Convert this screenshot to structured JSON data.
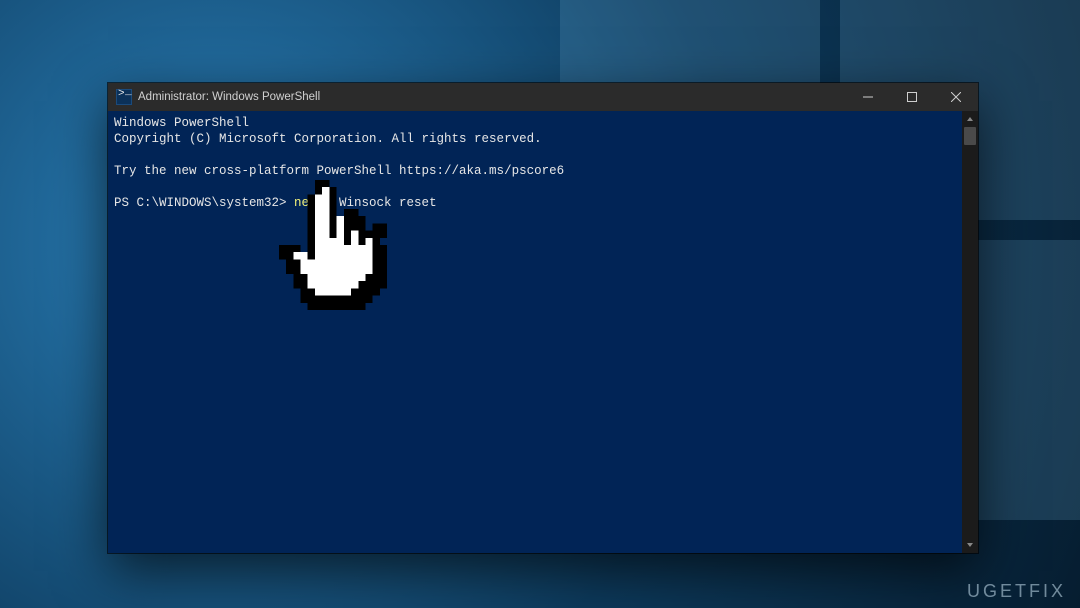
{
  "desktop": {
    "watermark": "UGETFIX"
  },
  "window": {
    "title": "Administrator: Windows PowerShell",
    "icons": {
      "app": "powershell-icon",
      "minimize": "minimize-icon",
      "maximize": "maximize-icon",
      "close": "close-icon"
    }
  },
  "terminal": {
    "line1": "Windows PowerShell",
    "line2": "Copyright (C) Microsoft Corporation. All rights reserved.",
    "line3": "",
    "line4": "Try the new cross-platform PowerShell https://aka.ms/pscore6",
    "line5": "",
    "prompt": "PS C:\\WINDOWS\\system32> ",
    "cmd_highlight": "netsh",
    "cmd_rest": " Winsock reset"
  },
  "cursor": {
    "name": "hand-pointer-cursor"
  },
  "colors": {
    "ps_bg": "#012456",
    "titlebar_bg": "#2b2b2b",
    "cmd_highlight": "#f2f27a",
    "text": "#e6e6e6"
  }
}
